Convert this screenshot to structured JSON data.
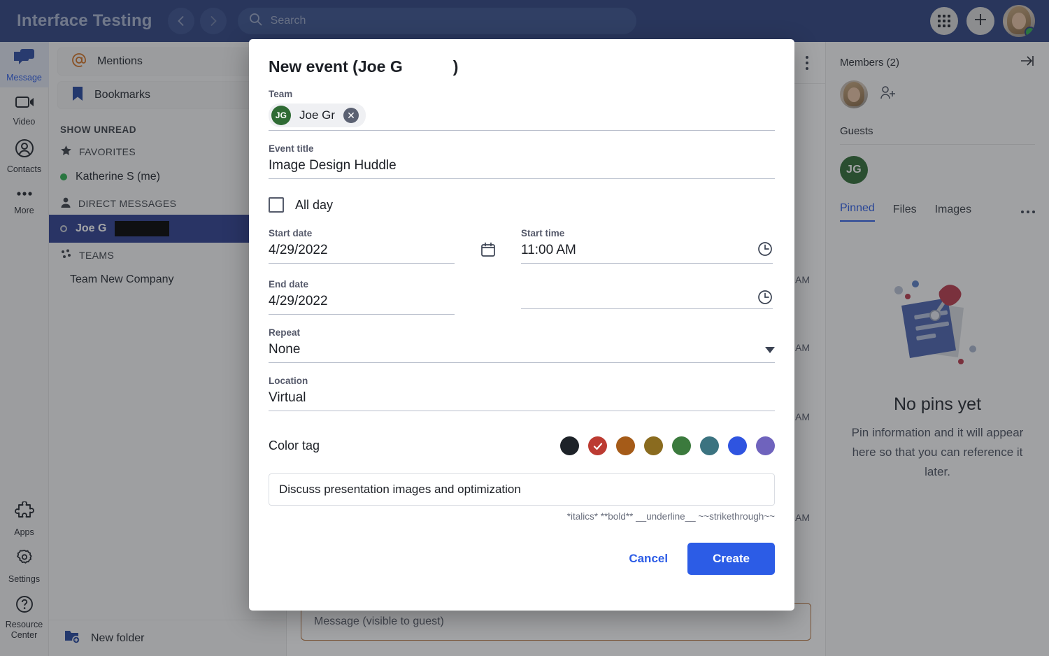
{
  "topbar": {
    "app_title": "Interface Testing",
    "back_icon": "chevron-left-icon",
    "forward_icon": "chevron-right-icon",
    "search_placeholder": "Search",
    "search_icon": "search-icon",
    "apps_grid_icon": "apps-grid-icon",
    "add_icon": "plus-icon",
    "avatar_name": "user-avatar",
    "presence_color": "#2eb050",
    "bg_color": "#2d4380"
  },
  "rail": {
    "items": [
      {
        "label": "Message",
        "icon": "message-icon",
        "active": true
      },
      {
        "label": "Video",
        "icon": "video-icon",
        "active": false
      },
      {
        "label": "Contacts",
        "icon": "contacts-icon",
        "active": false
      },
      {
        "label": "More",
        "icon": "more-dots-icon",
        "active": false
      }
    ],
    "bottom_items": [
      {
        "label": "Apps",
        "icon": "puzzle-icon"
      },
      {
        "label": "Settings",
        "icon": "gear-icon"
      },
      {
        "label": "Resource Center",
        "icon": "question-circle-icon"
      }
    ]
  },
  "sidebar": {
    "mentions": "Mentions",
    "mentions_icon": "at-icon",
    "bookmarks": "Bookmarks",
    "bookmarks_icon": "bookmark-icon",
    "show_unread": "SHOW UNREAD",
    "favorites": "FAVORITES",
    "favorites_icon": "star-icon",
    "favorite_user": "Katherine S (me)",
    "direct_messages": "DIRECT MESSAGES",
    "dm_icon": "person-icon",
    "dm_add": "+",
    "dm_selected": "Joe G",
    "teams": "TEAMS",
    "teams_icon": "teams-icon",
    "teams_add": "+",
    "team_item": "Team New Company",
    "new_folder": "New folder",
    "new_folder_icon": "folder-plus-icon"
  },
  "main": {
    "menu_icon": "vertical-dots-icon",
    "timestamps": [
      "AM",
      "AM",
      "AM",
      "AM"
    ],
    "composer_placeholder": "Message (visible to guest)",
    "composer_border": "#b5713a"
  },
  "right_panel": {
    "members_title": "Members (2)",
    "collapse_icon": "collapse-right-icon",
    "add_member_icon": "add-person-icon",
    "guests_title": "Guests",
    "guest_initials": "JG",
    "guest_color": "#2f6b34",
    "tabs": [
      {
        "label": "Pinned",
        "active": true
      },
      {
        "label": "Files",
        "active": false
      },
      {
        "label": "Images",
        "active": false
      }
    ],
    "tabs_more_icon": "horizontal-dots-icon",
    "empty_illustration": "pinned-note-illustration",
    "empty_title": "No pins yet",
    "empty_text": "Pin information and it will appear here so that you can reference it later."
  },
  "modal": {
    "title_prefix": "New event (Joe G",
    "title_suffix": ")",
    "team_label": "Team",
    "team_chip_initials": "JG",
    "team_chip_name": "Joe Gr",
    "team_chip_remove_icon": "close-circle-icon",
    "event_title_label": "Event title",
    "event_title_value": "Image Design Huddle",
    "all_day_label": "All day",
    "all_day_checked": false,
    "start_date_label": "Start date",
    "start_date_value": "4/29/2022",
    "calendar_icon": "calendar-icon",
    "start_time_label": "Start time",
    "start_time_value": "11:00 AM",
    "start_time_icon": "clock-icon",
    "end_date_label": "End date",
    "end_date_value": "4/29/2022",
    "end_time_value": "",
    "end_time_icon": "clock-icon",
    "repeat_label": "Repeat",
    "repeat_value": "None",
    "repeat_caret_icon": "chevron-down-icon",
    "location_label": "Location",
    "location_value": "Virtual",
    "color_tag_label": "Color tag",
    "color_swatches": [
      {
        "hex": "#1d2228",
        "selected": false
      },
      {
        "hex": "#bc3b32",
        "selected": true
      },
      {
        "hex": "#a55b18",
        "selected": false
      },
      {
        "hex": "#8a6b1f",
        "selected": false
      },
      {
        "hex": "#3b7a3d",
        "selected": false
      },
      {
        "hex": "#3b7380",
        "selected": false
      },
      {
        "hex": "#2f54e0",
        "selected": false
      },
      {
        "hex": "#6f63bd",
        "selected": false
      }
    ],
    "description_value": "Discuss presentation images and optimization",
    "markdown_hint": "*italics* **bold** __underline__ ~~strikethrough~~",
    "cancel_label": "Cancel",
    "create_label": "Create",
    "create_color": "#2c5ce6"
  }
}
